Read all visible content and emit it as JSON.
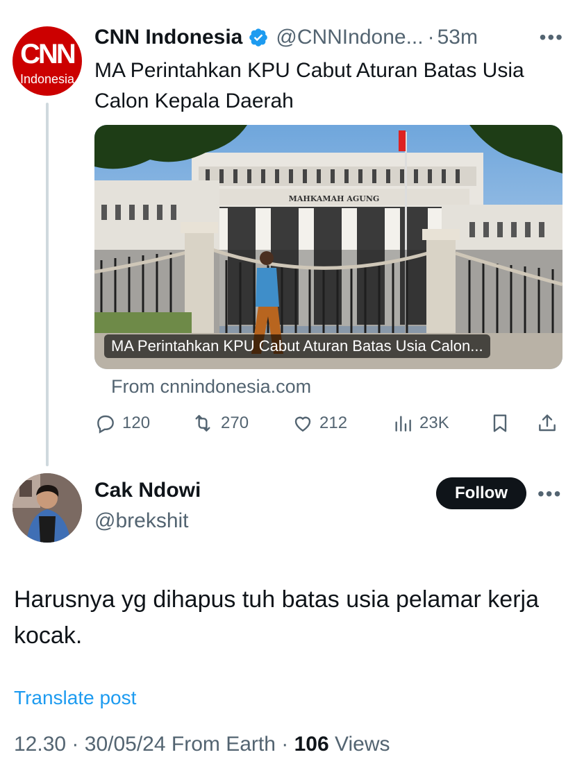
{
  "original_tweet": {
    "avatar": {
      "brand": "CNN",
      "subtitle": "Indonesia",
      "color": "#cc0000"
    },
    "author_name": "CNN Indonesia",
    "verified_icon": "verified-badge-icon",
    "handle": "@CNNIndone...",
    "separator": "·",
    "time": "53m",
    "more_icon": "more-dots-icon",
    "text": "MA Perintahkan KPU Cabut Aturan Batas Usia Calon Kepala Daerah",
    "card": {
      "caption": "MA Perintahkan KPU Cabut Aturan Batas Usia Calon...",
      "building_sign": "MAHKAMAH AGUNG",
      "source": "From cnnindonesia.com"
    },
    "actions": {
      "replies": "120",
      "reposts": "270",
      "likes": "212",
      "views": "23K",
      "icons": [
        "reply-icon",
        "repost-icon",
        "like-icon",
        "views-icon",
        "bookmark-icon",
        "share-icon"
      ]
    }
  },
  "reply_tweet": {
    "author_name": "Cak Ndowi",
    "handle": "@brekshit",
    "follow_label": "Follow",
    "more_icon": "more-dots-icon",
    "text": "Harusnya yg dihapus tuh batas usia pelamar kerja kocak.",
    "translate_label": "Translate post",
    "meta": {
      "time": "12.30",
      "dot1": "·",
      "date": "30/05/24",
      "location": "From Earth",
      "dot2": "·",
      "views_count": "106",
      "views_label": "Views"
    }
  },
  "colors": {
    "accent": "#1d9bf0",
    "muted": "#536471",
    "text": "#0f1419",
    "follow_bg": "#0f1419"
  }
}
